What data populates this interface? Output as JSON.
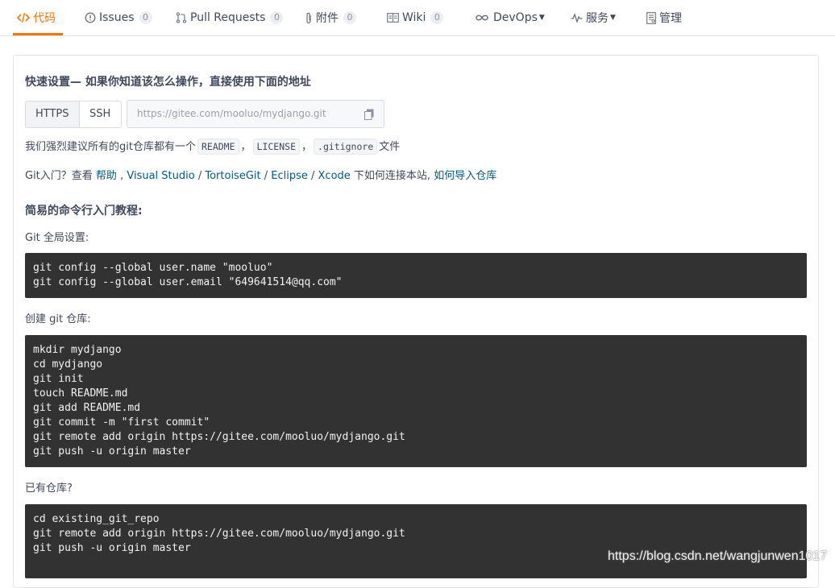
{
  "tabs": [
    {
      "label": "代码",
      "icon": "code-icon",
      "active": true,
      "badge": null
    },
    {
      "label": "Issues",
      "icon": "issue-icon",
      "badge": "0"
    },
    {
      "label": "Pull Requests",
      "icon": "pull-request-icon",
      "badge": "0"
    },
    {
      "label": "附件",
      "icon": "attachment-icon",
      "badge": "0"
    },
    {
      "label": "Wiki",
      "icon": "wiki-icon",
      "badge": "0"
    },
    {
      "label": "DevOps",
      "icon": "infinity-icon",
      "dropdown": true
    },
    {
      "label": "服务",
      "icon": "pulse-icon",
      "dropdown": true
    },
    {
      "label": "管理",
      "icon": "manage-icon"
    }
  ],
  "quick_setup": {
    "title": "快速设置— 如果你知道该怎么操作，直接使用下面的地址",
    "protocols": [
      "HTTPS",
      "SSH"
    ],
    "url": "https://gitee.com/mooluo/mydjango.git",
    "recommend_prefix": "我们强烈建议所有的git仓库都有一个",
    "files": [
      "README",
      "LICENSE",
      ".gitignore"
    ],
    "comma": "，",
    "recommend_suffix": "文件",
    "help_prefix": "Git入门？查看 ",
    "help_links": [
      "帮助",
      "Visual Studio",
      "TortoiseGit",
      "Eclipse",
      "Xcode"
    ],
    "help_middle": " 下如何连接本站, ",
    "import_link": "如何导入仓库"
  },
  "tutorial": {
    "title": "简易的命令行入门教程:",
    "global_label": "Git 全局设置:",
    "global_code": [
      "git config --global user.name \"mooluo\"",
      "git config --global user.email \"649641514@qq.com\""
    ],
    "create_label": "创建 git 仓库:",
    "create_code": [
      "mkdir mydjango",
      "cd mydjango",
      "git init",
      "touch README.md",
      "git add README.md",
      "git commit -m \"first commit\"",
      "git remote add origin https://gitee.com/mooluo/mydjango.git",
      "git push -u origin master"
    ],
    "existing_label": "已有仓库?",
    "existing_code": [
      "cd existing_git_repo",
      "git remote add origin https://gitee.com/mooluo/mydjango.git",
      "git push -u origin master"
    ]
  },
  "watermark": "https://blog.csdn.net/wangjunwen1017",
  "colors": {
    "accent": "#fe7300",
    "link": "#005980",
    "code_bg": "#323232"
  }
}
